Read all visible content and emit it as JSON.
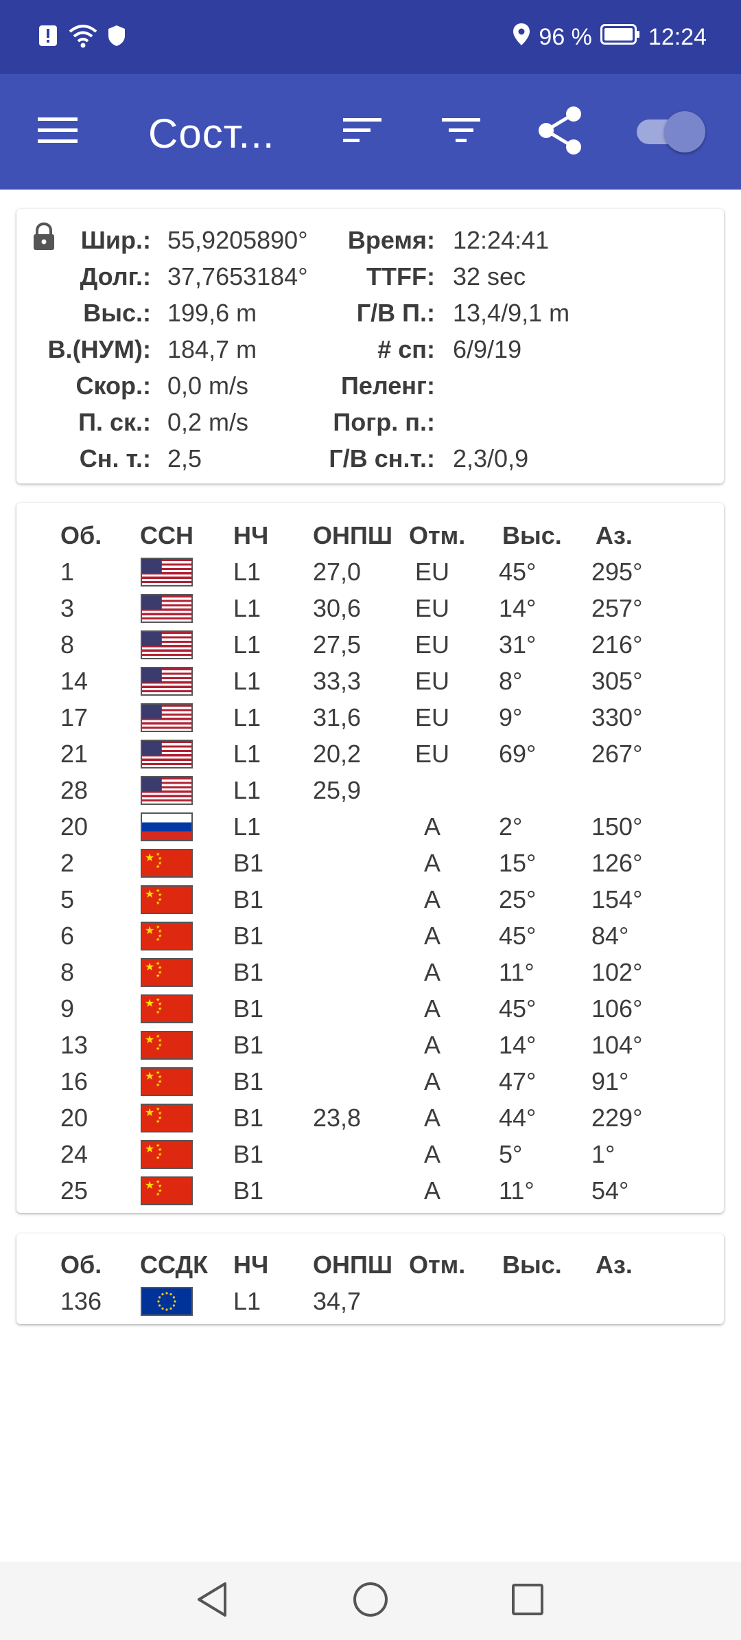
{
  "status_bar": {
    "battery": "96 %",
    "time": "12:24"
  },
  "toolbar": {
    "title": "Сост...",
    "menu_icon": "menu-icon",
    "sort_icon": "sort-icon",
    "filter_icon": "filter-icon",
    "share_icon": "share-icon",
    "toggle_on": true
  },
  "fix": {
    "rows": [
      {
        "l1": "Шир.:",
        "v1": "55,9205890°",
        "l2": "Время:",
        "v2": "12:24:41"
      },
      {
        "l1": "Долг.:",
        "v1": "37,7653184°",
        "l2": "TTFF:",
        "v2": "32 sec"
      },
      {
        "l1": "Выс.:",
        "v1": "199,6 m",
        "l2": "Г/В П.:",
        "v2": "13,4/9,1 m"
      },
      {
        "l1": "В.(НУМ):",
        "v1": "184,7 m",
        "l2": "# сп:",
        "v2": "6/9/19"
      },
      {
        "l1": "Скор.:",
        "v1": "0,0 m/s",
        "l2": "Пеленг:",
        "v2": ""
      },
      {
        "l1": "П. ск.:",
        "v1": "0,2 m/s",
        "l2": "Погр. п.:",
        "v2": ""
      },
      {
        "l1": "Сн. т.:",
        "v1": "2,5",
        "l2": "Г/В сн.т.:",
        "v2": "2,3/0,9"
      }
    ]
  },
  "gnss": {
    "headers": {
      "id": "Об.",
      "gnss": "ССН",
      "cf": "НЧ",
      "cn0": "ОНПШ",
      "flags": "Отм.",
      "elev": "Выс.",
      "azim": "Аз."
    },
    "rows": [
      {
        "id": "1",
        "flag": "us",
        "cf": "L1",
        "cn0": "27,0",
        "flags": "EU",
        "elev": "45°",
        "azim": "295°"
      },
      {
        "id": "3",
        "flag": "us",
        "cf": "L1",
        "cn0": "30,6",
        "flags": "EU",
        "elev": "14°",
        "azim": "257°"
      },
      {
        "id": "8",
        "flag": "us",
        "cf": "L1",
        "cn0": "27,5",
        "flags": "EU",
        "elev": "31°",
        "azim": "216°"
      },
      {
        "id": "14",
        "flag": "us",
        "cf": "L1",
        "cn0": "33,3",
        "flags": "EU",
        "elev": "8°",
        "azim": "305°"
      },
      {
        "id": "17",
        "flag": "us",
        "cf": "L1",
        "cn0": "31,6",
        "flags": "EU",
        "elev": "9°",
        "azim": "330°"
      },
      {
        "id": "21",
        "flag": "us",
        "cf": "L1",
        "cn0": "20,2",
        "flags": "EU",
        "elev": "69°",
        "azim": "267°"
      },
      {
        "id": "28",
        "flag": "us",
        "cf": "L1",
        "cn0": "25,9",
        "flags": "",
        "elev": "",
        "azim": ""
      },
      {
        "id": "20",
        "flag": "ru",
        "cf": "L1",
        "cn0": "",
        "flags": "A",
        "elev": "2°",
        "azim": "150°"
      },
      {
        "id": "2",
        "flag": "cn",
        "cf": "B1",
        "cn0": "",
        "flags": "A",
        "elev": "15°",
        "azim": "126°"
      },
      {
        "id": "5",
        "flag": "cn",
        "cf": "B1",
        "cn0": "",
        "flags": "A",
        "elev": "25°",
        "azim": "154°"
      },
      {
        "id": "6",
        "flag": "cn",
        "cf": "B1",
        "cn0": "",
        "flags": "A",
        "elev": "45°",
        "azim": "84°"
      },
      {
        "id": "8",
        "flag": "cn",
        "cf": "B1",
        "cn0": "",
        "flags": "A",
        "elev": "11°",
        "azim": "102°"
      },
      {
        "id": "9",
        "flag": "cn",
        "cf": "B1",
        "cn0": "",
        "flags": "A",
        "elev": "45°",
        "azim": "106°"
      },
      {
        "id": "13",
        "flag": "cn",
        "cf": "B1",
        "cn0": "",
        "flags": "A",
        "elev": "14°",
        "azim": "104°"
      },
      {
        "id": "16",
        "flag": "cn",
        "cf": "B1",
        "cn0": "",
        "flags": "A",
        "elev": "47°",
        "azim": "91°"
      },
      {
        "id": "20",
        "flag": "cn",
        "cf": "B1",
        "cn0": "23,8",
        "flags": "A",
        "elev": "44°",
        "azim": "229°"
      },
      {
        "id": "24",
        "flag": "cn",
        "cf": "B1",
        "cn0": "",
        "flags": "A",
        "elev": "5°",
        "azim": "1°"
      },
      {
        "id": "25",
        "flag": "cn",
        "cf": "B1",
        "cn0": "",
        "flags": "A",
        "elev": "11°",
        "azim": "54°"
      }
    ]
  },
  "sbas": {
    "headers": {
      "id": "Об.",
      "gnss": "ССДК",
      "cf": "НЧ",
      "cn0": "ОНПШ",
      "flags": "Отм.",
      "elev": "Выс.",
      "azim": "Аз."
    },
    "rows": [
      {
        "id": "136",
        "flag": "eu",
        "cf": "L1",
        "cn0": "34,7",
        "flags": "",
        "elev": "",
        "azim": ""
      }
    ]
  },
  "nav": {
    "back_icon": "back-icon",
    "home_icon": "home-icon",
    "recents_icon": "recents-icon"
  }
}
